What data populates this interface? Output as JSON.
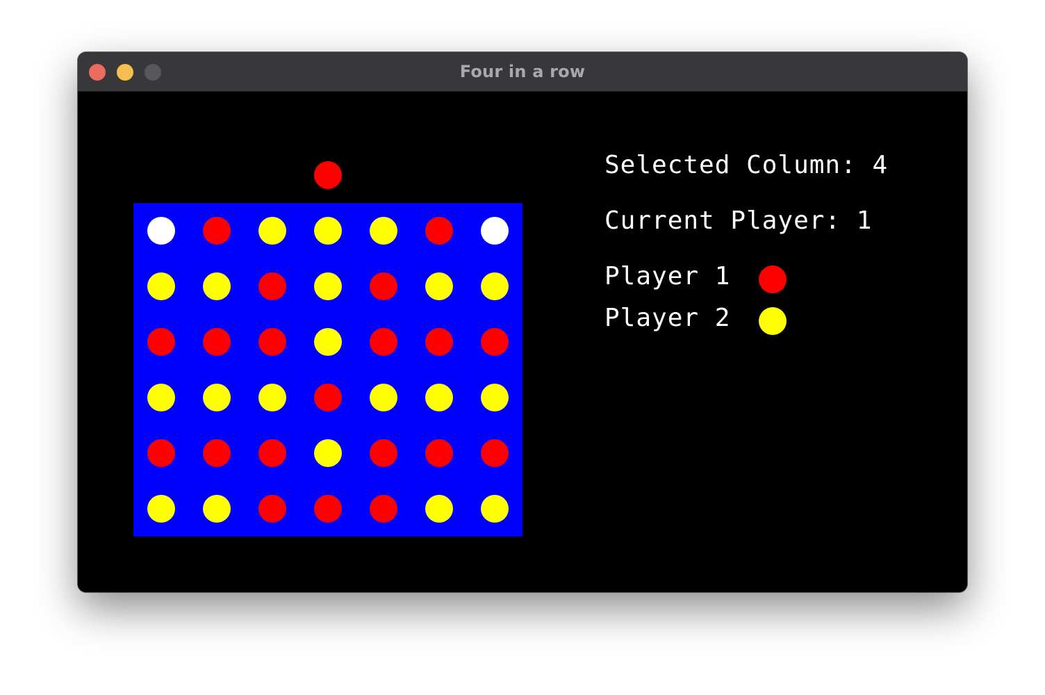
{
  "window": {
    "title": "Four in a row"
  },
  "colors": {
    "board": "#0000ff",
    "empty": "#ffffff",
    "player1": "#ff0000",
    "player2": "#ffff00",
    "background": "#000000"
  },
  "game": {
    "selected_column": 4,
    "current_player": 1,
    "columns": 7,
    "rows": 6,
    "grid": [
      [
        0,
        1,
        2,
        2,
        2,
        1,
        0
      ],
      [
        2,
        2,
        1,
        2,
        1,
        2,
        2
      ],
      [
        1,
        1,
        1,
        2,
        1,
        1,
        1
      ],
      [
        2,
        2,
        2,
        1,
        2,
        2,
        2
      ],
      [
        1,
        1,
        1,
        2,
        1,
        1,
        1
      ],
      [
        2,
        2,
        1,
        1,
        1,
        2,
        2
      ]
    ]
  },
  "info": {
    "selected_column_text": "Selected Column: 4",
    "current_player_text": "Current Player: 1",
    "player1_label": "Player 1",
    "player2_label": "Player 2"
  }
}
